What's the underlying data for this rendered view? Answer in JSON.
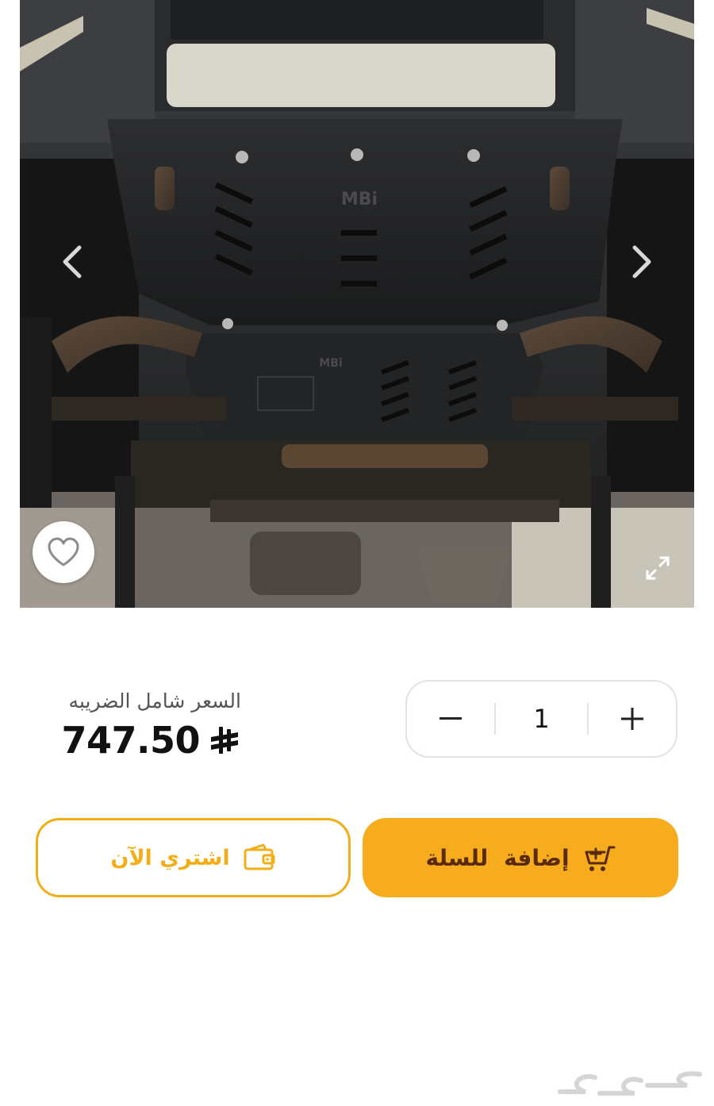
{
  "gallery": {
    "photo_description_icon": "product-photo",
    "brand_mark": "MBi",
    "prev_icon": "chevron-left-icon",
    "next_icon": "chevron-right-icon",
    "favorite_icon": "heart-icon",
    "expand_icon": "expand-icon"
  },
  "price": {
    "label": "السعر شامل الضريبه",
    "value": "747.50",
    "currency_icon": "saudi-riyal-icon"
  },
  "quantity": {
    "value": "1",
    "decrement_icon": "minus-icon",
    "increment_icon": "plus-icon"
  },
  "actions": {
    "buy_now_label": "اشتري الآن",
    "buy_now_icon": "wallet-icon",
    "add_to_cart_label": "إضافة للسلة",
    "add_to_cart_icon": "cart-plus-icon"
  },
  "colors": {
    "accent": "#f7ac1e",
    "accent_text": "#5a2a0c",
    "outline": "#f3ad17",
    "text_primary": "#111111",
    "text_secondary": "#555555"
  },
  "watermark": {
    "logo": "haraj-logo"
  }
}
